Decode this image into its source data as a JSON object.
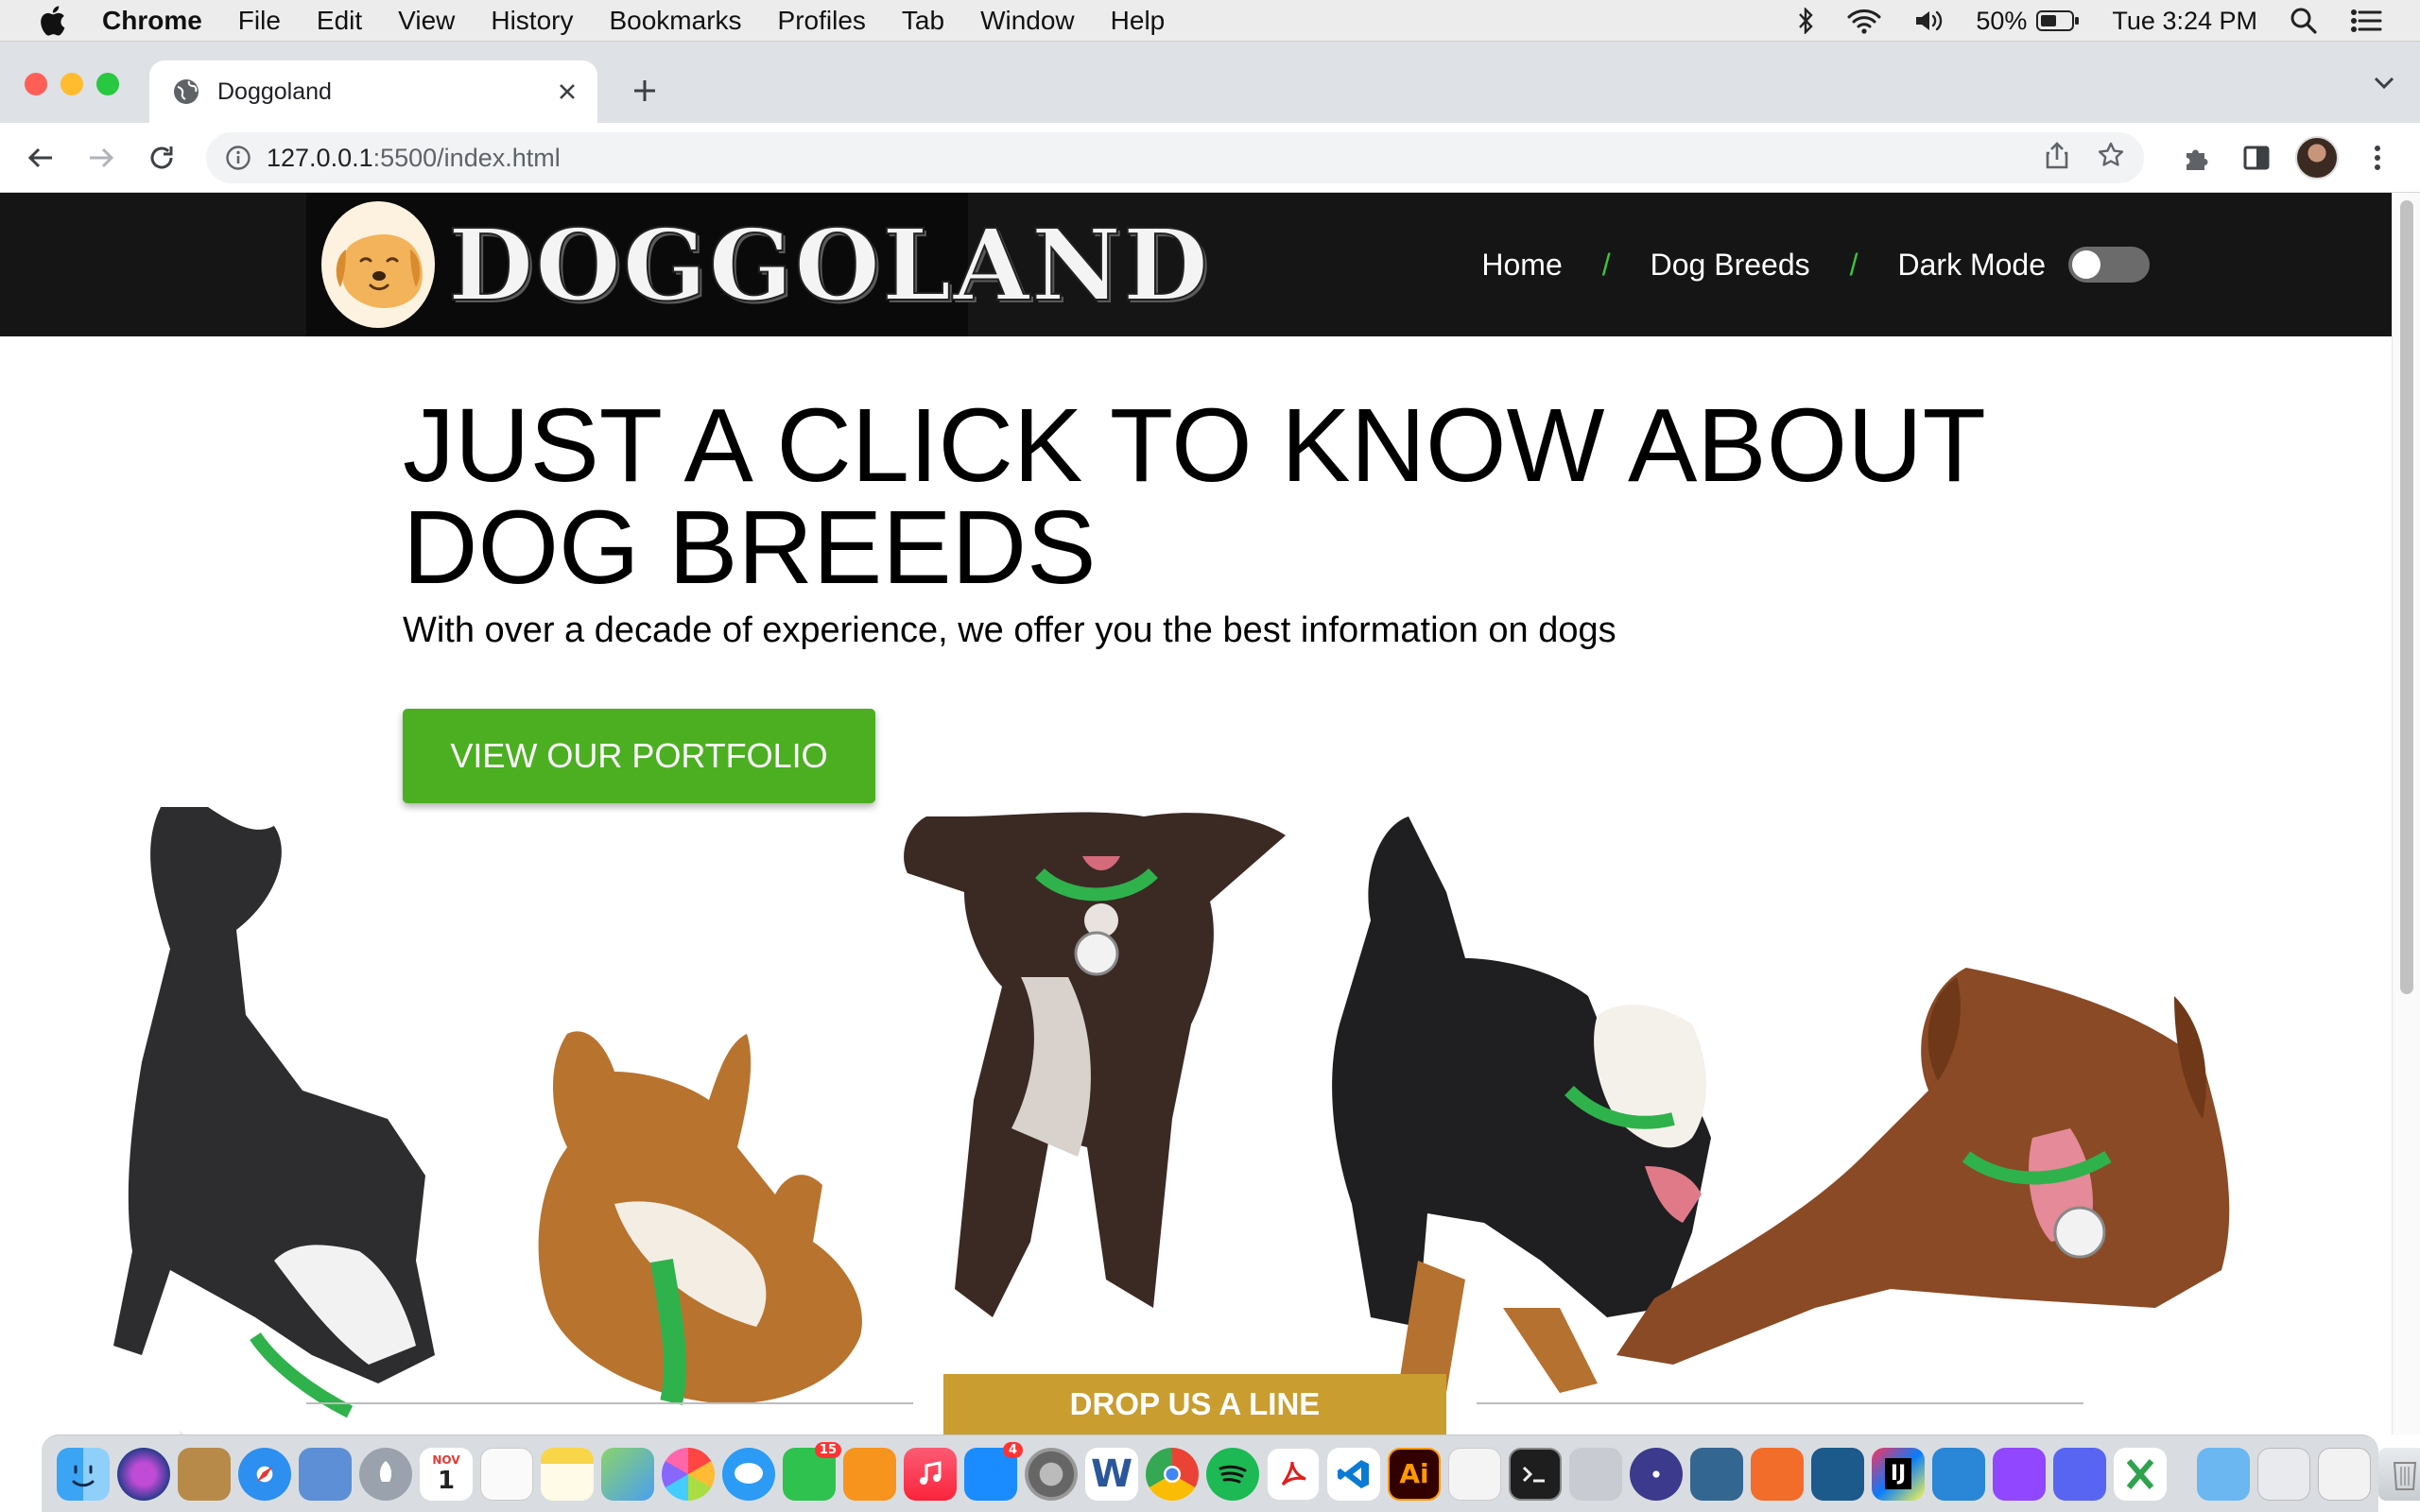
{
  "menubar": {
    "app_name": "Chrome",
    "items": [
      "File",
      "Edit",
      "View",
      "History",
      "Bookmarks",
      "Profiles",
      "Tab",
      "Window",
      "Help"
    ],
    "battery": "50%",
    "clock": "Tue 3:24 PM"
  },
  "browser": {
    "tab_title": "Doggoland",
    "url_host": "127.0.0.1",
    "url_path": ":5500/index.html"
  },
  "site": {
    "logo_text": "DOGGOLAND",
    "nav": {
      "home": "Home",
      "breeds": "Dog Breeds",
      "dark_mode": "Dark Mode",
      "separator": "/",
      "dark_mode_on": false
    },
    "hero": {
      "title": "JUST A CLICK TO KNOW ABOUT DOG BREEDS",
      "subtitle": "With over a decade of experience, we offer you the best information on dogs",
      "cta": "VIEW OUR PORTFOLIO"
    },
    "drop_line": "DROP US A LINE"
  },
  "colors": {
    "header_bg": "#151515",
    "cta_green": "#4caf22",
    "nav_separator": "#3cc33c",
    "drop_gold": "#c99d2f"
  },
  "dock": {
    "apps": [
      "finder",
      "siri",
      "notefile",
      "safari",
      "preview",
      "launchpad",
      "calendar",
      "reminders",
      "notes",
      "maps",
      "photos",
      "messages",
      "facetime",
      "books",
      "music",
      "app-store",
      "system-preferences",
      "word",
      "chrome",
      "spotify",
      "acrobat",
      "vscode",
      "illustrator",
      "textedit",
      "terminal",
      "utility",
      "eclipse",
      "postgres",
      "sketch",
      "mysql-workbench",
      "intellij",
      "remote-desktop",
      "twitch",
      "discord",
      "excel",
      "downloads",
      "screenshots",
      "preview-stack",
      "trash"
    ],
    "calendar_month": "NOV",
    "calendar_day": "1",
    "messages_badge": "15",
    "appstore_badge": "4",
    "ai_label": "Ai",
    "word_label": "W",
    "intellij_label": "IJ"
  }
}
